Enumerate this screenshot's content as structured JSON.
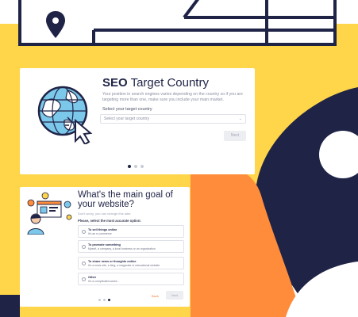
{
  "colors": {
    "navy": "#1f2346",
    "yellow": "#ffd54a",
    "orange": "#ff8c3b",
    "white": "#ffffff"
  },
  "icons": {
    "pin": "map-pin-icon",
    "globe": "globe-cursor-icon",
    "chevron": "chevron-down-icon"
  },
  "card1": {
    "title_bold": "SEO",
    "title_rest": " Target Country",
    "description": "Your position in search engines varies depending on the country so if you are targeting more than one, make sure you include your main market.",
    "select_label": "Select your target country",
    "select_placeholder": "Select your target country",
    "next_label": "Next",
    "active_step": 1
  },
  "card2": {
    "title": "What's the main goal of your website?",
    "subtitle": "Don't worry, you can change this later.",
    "prompt": "Please, select the most accurate option:",
    "options": [
      {
        "title": "To sell things online",
        "desc": "It's an e-commerce"
      },
      {
        "title": "To promote something",
        "desc": "Myself, a company, a local business or an organization"
      },
      {
        "title": "To share news or thoughts online",
        "desc": "It's a news site, a blog, a magazine or educational website"
      },
      {
        "title": "Other",
        "desc": "It's a complicated world..."
      }
    ],
    "back_label": "Back",
    "next_label": "Next",
    "active_step": 3
  }
}
